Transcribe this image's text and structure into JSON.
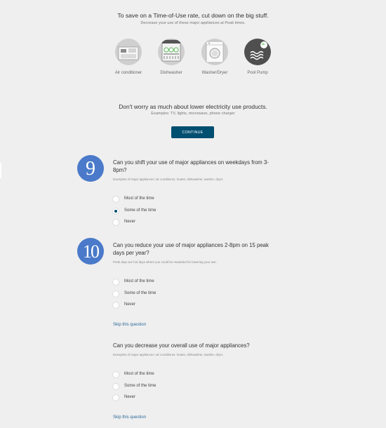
{
  "intro": {
    "headline": "To save on a Time-of-Use rate, cut down on the big stuff.",
    "subhead": "Decrease your use of these major appliances at Peak times."
  },
  "appliances": [
    {
      "label": "Air conditioner",
      "icon": "air-conditioner-icon"
    },
    {
      "label": "Dishwasher",
      "icon": "dishwasher-icon"
    },
    {
      "label": "Washer/Dryer",
      "icon": "washer-dryer-icon"
    },
    {
      "label": "Pool Pump",
      "icon": "pool-pump-icon",
      "badge": "$$"
    }
  ],
  "note": {
    "headline": "Don't worry as much about lower electricity use products.",
    "examples": "Examples: TV, lights, microwave, phone charger"
  },
  "continue_label": "CONTINUE",
  "questions": [
    {
      "number": "9",
      "title": "Can you shift your use of major appliances on weekdays from 3-8pm?",
      "hint": "Examples of major appliances: air conditioner, heater, dishwasher, washer, dryer.",
      "options": [
        "Most of the time",
        "Some of the time",
        "Never"
      ],
      "selected": "Some of the time"
    },
    {
      "number": "10",
      "title": "Can you reduce your use of major appliances 2-8pm on 15 peak days per year?",
      "hint": "Peak days are hot days where you could be rewarded for lowering your use.",
      "options": [
        "Most of the time",
        "Some of the time",
        "Never"
      ],
      "selected": null,
      "skip": "Skip this question"
    },
    {
      "title": "Can you decrease your overall use of major appliances?",
      "hint": "Examples of major appliances: air conditioner, heater, dishwasher, washer, dryer.",
      "options": [
        "Most of the time",
        "Some of the time",
        "Never"
      ],
      "selected": null,
      "skip": "Skip this question"
    }
  ],
  "colors": {
    "background": "#efefef",
    "button": "#004e70",
    "badge": "#4a7ac9",
    "link": "#2b6a9b",
    "pool_pump_badge": "#5cc05c"
  }
}
